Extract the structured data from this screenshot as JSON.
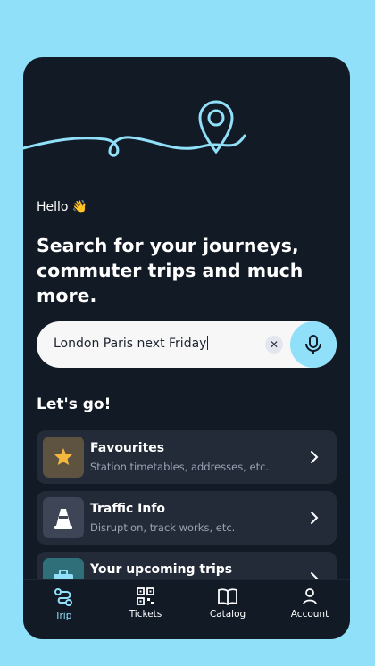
{
  "greeting": {
    "text": "Hello 👋"
  },
  "headline": "Search for your journeys, commuter trips and much more.",
  "search": {
    "value": "London Paris next Friday",
    "clear_icon": "close-icon",
    "mic_icon": "microphone-icon"
  },
  "section_title": "Let's go!",
  "cards": [
    {
      "title": "Favourites",
      "subtitle": "Station timetables, addresses, etc.",
      "icon": "star-icon"
    },
    {
      "title": "Traffic Info",
      "subtitle": "Disruption, track works, etc.",
      "icon": "traffic-cone-icon"
    },
    {
      "title": "Your upcoming trips",
      "subtitle": "",
      "icon": "suitcase-icon"
    }
  ],
  "tabs": [
    {
      "label": "Trip",
      "icon": "route-icon",
      "active": true
    },
    {
      "label": "Tickets",
      "icon": "qr-code-icon",
      "active": false
    },
    {
      "label": "Catalog",
      "icon": "book-icon",
      "active": false
    },
    {
      "label": "Account",
      "icon": "person-icon",
      "active": false
    }
  ],
  "colors": {
    "background": "#8fe0f8",
    "panel": "#121a26",
    "card": "#232b38",
    "accent": "#8fe0f8",
    "star": "#f5b83d"
  }
}
